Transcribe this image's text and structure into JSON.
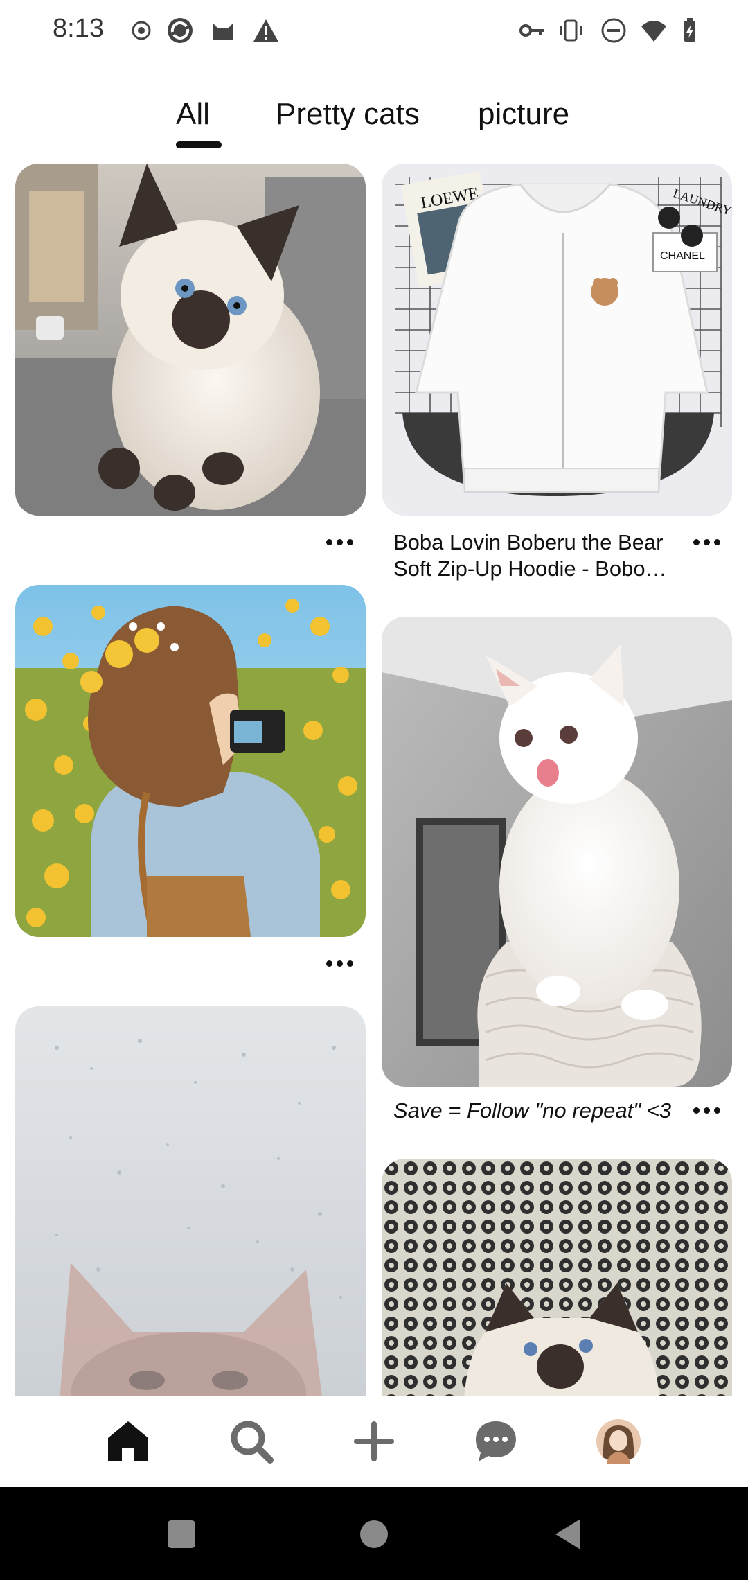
{
  "status_bar": {
    "time": "8:13"
  },
  "tabs": [
    {
      "label": "All",
      "active": true
    },
    {
      "label": "Pretty cats",
      "active": false
    },
    {
      "label": "picture",
      "active": false
    }
  ],
  "feed": {
    "pins": [
      {
        "id": "kitten-siamese",
        "caption": ""
      },
      {
        "id": "hoodie",
        "caption_line1": "Boba Lovin Boberu the Bear",
        "caption_line2": "Soft Zip-Up Hoodie - Bobo…"
      },
      {
        "id": "girl-camera",
        "caption": ""
      },
      {
        "id": "white-kitten",
        "caption": "Save = Follow \"no repeat\" <3"
      },
      {
        "id": "rain-cat",
        "caption": ""
      },
      {
        "id": "kitten-pattern",
        "caption": ""
      }
    ],
    "image_labels": {
      "loewe": "LOEWE",
      "chanel": "CHANEL",
      "laundry": "LAUNDRY"
    }
  },
  "icons": {
    "home": "home-icon",
    "search": "search-icon",
    "create": "plus-icon",
    "messages": "chat-icon",
    "profile": "avatar"
  }
}
